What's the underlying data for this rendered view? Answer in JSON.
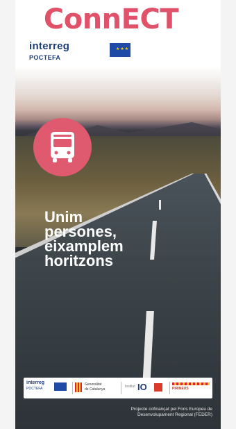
{
  "poster": {
    "title": "ConnECT",
    "title_color": "#e0526a",
    "program_logo": {
      "name": "interreg",
      "subtitle": "POCTEFA",
      "flag_icon": "eu-flag-icon",
      "flag_stars": "★★★"
    },
    "badge_icon": "bus-icon",
    "badge_color": "#e05a6f",
    "slogan_lines": [
      "Unim",
      "persones,",
      "eixamplem",
      "horitzons"
    ],
    "logos_bar": {
      "interreg_name": "interreg",
      "interreg_sub": "POCTEFA",
      "gencat_line1": "Generalitat",
      "gencat_line2": "de Catalunya",
      "io_prefix": "Institut",
      "io_mark": "IO",
      "pirineus_label": "PIRINEUS"
    },
    "footer_line1": "Projecte cofinançat pel Fons Europeu de",
    "footer_line2": "Desenvolupament Regional (FEDER)"
  }
}
